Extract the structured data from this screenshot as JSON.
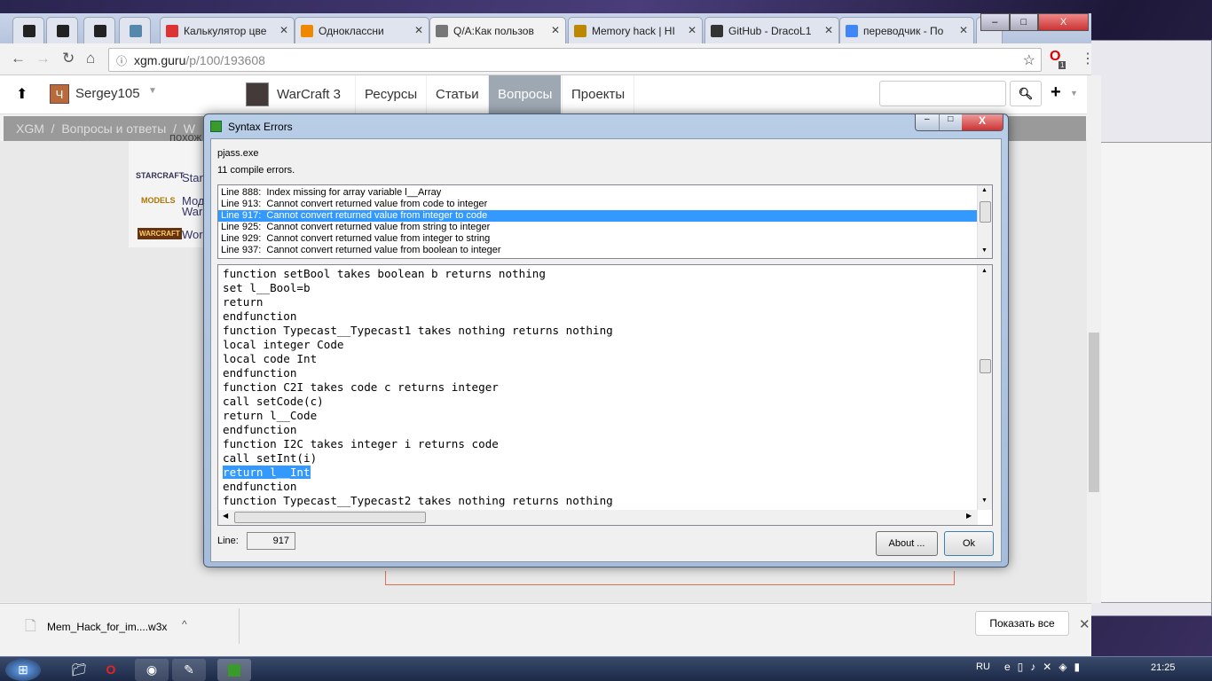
{
  "browser": {
    "tabs": [
      {
        "label": "",
        "icon": "film-icon"
      },
      {
        "label": "",
        "icon": "film-icon"
      },
      {
        "label": "",
        "icon": "film-icon"
      },
      {
        "label": "",
        "icon": "home-icon"
      },
      {
        "label": "Калькулятор цве",
        "icon": "app-icon"
      },
      {
        "label": "Одноклассни",
        "icon": "music-icon"
      },
      {
        "label": "Q/A:Как пользов",
        "icon": "xgm-icon",
        "active": true
      },
      {
        "label": "Memory hack | HI",
        "icon": "h-icon"
      },
      {
        "label": "GitHub - DracoL1",
        "icon": "github-icon"
      },
      {
        "label": "переводчик - По",
        "icon": "google-icon"
      }
    ],
    "url_host": "xgm.guru",
    "url_path": "/p/100/193608",
    "extension_badge": "1"
  },
  "site": {
    "user": "Sergey105",
    "user_avatar": "Ч",
    "nav": [
      "WarCraft 3",
      "Ресурсы",
      "Статьи",
      "Вопросы",
      "Проекты"
    ],
    "active_nav": "Вопросы",
    "breadcrumb": [
      "XGM",
      "/",
      "Вопросы и ответы",
      "/",
      "W"
    ],
    "similar_label": "похож",
    "side_links": [
      "Star",
      "Мод",
      "War",
      "Wor"
    ]
  },
  "download": {
    "file": "Mem_Hack_for_im....w3x",
    "show_all": "Показать все"
  },
  "dialog": {
    "title": "Syntax Errors",
    "program": "pjass.exe",
    "summary": "11 compile errors.",
    "errors": [
      "Line 888:  Index missing for array variable l__Array",
      "Line 913:  Cannot convert returned value from code to integer",
      "Line 917:  Cannot convert returned value from integer to code",
      "Line 925:  Cannot convert returned value from string to integer",
      "Line 929:  Cannot convert returned value from integer to string",
      "Line 937:  Cannot convert returned value from boolean to integer"
    ],
    "selected_error_index": 2,
    "code": [
      "function setBool takes boolean b returns nothing",
      "set l__Bool=b",
      "return",
      "endfunction",
      "function Typecast__Typecast1 takes nothing returns nothing",
      "local integer Code",
      "local code Int",
      "endfunction",
      "function C2I takes code c returns integer",
      "call setCode(c)",
      "return l__Code",
      "endfunction",
      "function I2C takes integer i returns code",
      "call setInt(i)",
      "return l__Int",
      "endfunction",
      "function Typecast__Typecast2 takes nothing returns nothing"
    ],
    "highlighted_code_index": 14,
    "line_label": "Line:",
    "line_value": "917",
    "about_label": "About ...",
    "ok_label": "Ok"
  },
  "taskbar": {
    "lang": "RU",
    "time": "21:25"
  }
}
